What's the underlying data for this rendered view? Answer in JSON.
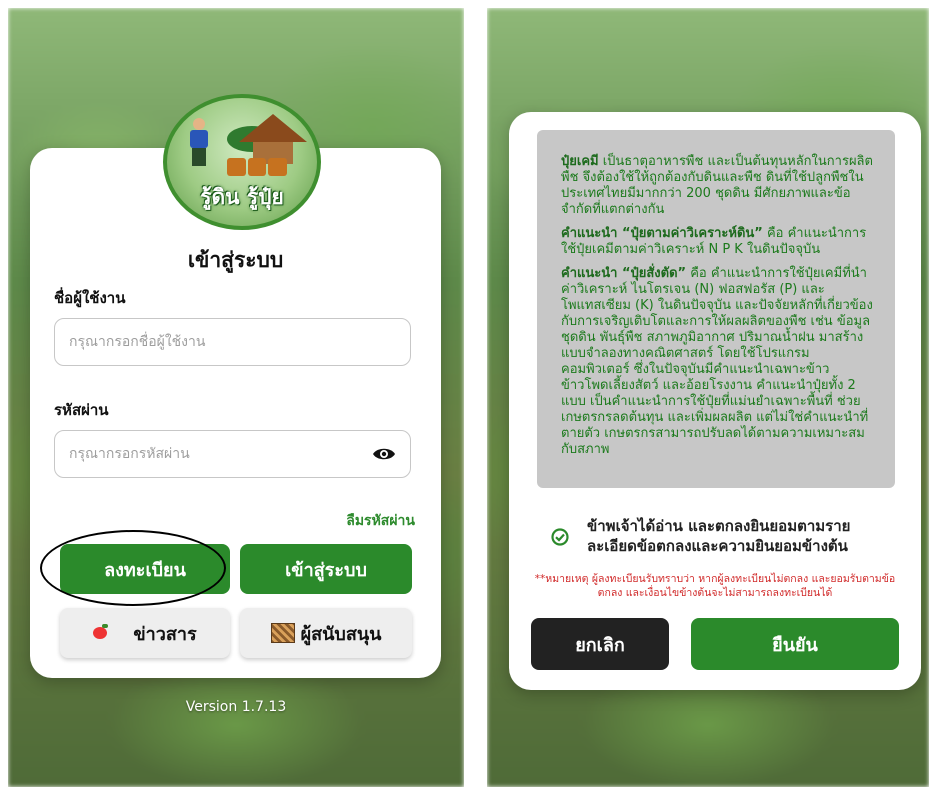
{
  "login": {
    "logo_text": "รู้ดิน รู้ปุ๋ย",
    "title": "เข้าสู่ระบบ",
    "username_label": "ชื่อผู้ใช้งาน",
    "username_placeholder": "กรุณากรอกชื่อผู้ใช้งาน",
    "password_label": "รหัสผ่าน",
    "password_placeholder": "กรุณากรอกรหัสผ่าน",
    "forgot_password": "ลืมรหัสผ่าน",
    "register_button": "ลงทะเบียน",
    "login_button": "เข้าสู่ระบบ",
    "news_button": "ข่าวสาร",
    "sponsor_button": "ผู้สนับสนุน",
    "version": "Version 1.7.13"
  },
  "terms": {
    "p1_bold": "ปุ๋ยเคมี",
    "p1_text": " เป็นธาตุอาหารพืช และเป็นต้นทุนหลักในการผลิตพืช จึงต้องใช้ให้ถูกต้องกับดินและพืช ดินที่ใช้ปลูกพืชในประเทศไทยมีมากกว่า 200 ชุดดิน มีศักยภาพและข้อจำกัดที่แตกต่างกัน",
    "p2_bold": "คำแนะนำ “ปุ๋ยตามค่าวิเคราะห์ดิน”",
    "p2_text": " คือ คำแนะนำการใช้ปุ๋ยเคมีตามค่าวิเคราะห์ N P K ในดินปัจจุบัน",
    "p3_bold": "คำแนะนำ “ปุ๋ยสั่งตัด”",
    "p3_text": " คือ คำแนะนำการใช้ปุ๋ยเคมีที่นำค่าวิเคราะห์ ไนโตรเจน (N) ฟอสฟอรัส (P) และโพแทสเซียม (K) ในดินปัจจุบัน และปัจจัยหลักที่เกี่ยวข้องกับการเจริญเติบโตและการให้ผลผลิตของพืช เช่น ข้อมูลชุดดิน พันธุ์พืช สภาพภูมิอากาศ ปริมาณน้ำฝน มาสร้างแบบจำลองทางคณิตศาสตร์ โดยใช้โปรแกรมคอมพิวเตอร์ ซึ่งในปัจจุบันมีคำแนะนำเฉพาะข้าว ข้าวโพดเลี้ยงสัตว์ และอ้อยโรงงาน คำแนะนำปุ๋ยทั้ง 2 แบบ เป็นคำแนะนำการใช้ปุ๋ยที่แม่นยำเฉพาะพื้นที่ ช่วยเกษตรกรลดต้นทุน และเพิ่มผลผลิต แต่ไม่ใช่คำแนะนำที่ตายตัว เกษตรกรสามารถปรับลดได้ตามความเหมาะสมกับสภาพ",
    "agree_text": "ข้าพเจ้าได้อ่าน และตกลงยินยอมตามรายละเอียดข้อตกลงและความยินยอมข้างต้น",
    "note": "**หมายเหตุ ผู้ลงทะเบียนรับทราบว่า หากผู้ลงทะเบียนไม่ตกลง และยอมรับตามข้อตกลง และเงื่อนไขข้างต้นจะไม่สามารถลงทะเบียนได้",
    "cancel_button": "ยกเลิก",
    "confirm_button": "ยืนยัน"
  },
  "colors": {
    "primary_green": "#2b8a2b",
    "dark_button": "#222222",
    "note_red": "#d12a2a",
    "terms_text_green": "#1c7a1c"
  }
}
